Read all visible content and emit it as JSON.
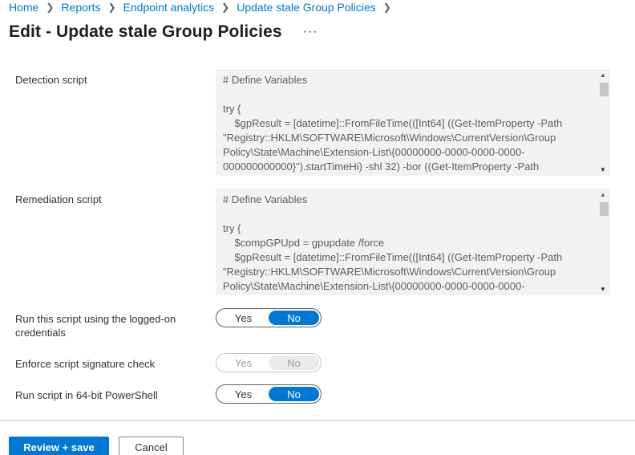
{
  "breadcrumb": [
    "Home",
    "Reports",
    "Endpoint analytics",
    "Update stale Group Policies"
  ],
  "page": {
    "title": "Edit - Update stale Group Policies",
    "more": "···"
  },
  "fields": {
    "detection": {
      "label": "Detection script",
      "content": "# Define Variables\n\ntry {\n    $gpResult = [datetime]::FromFileTime(([Int64] ((Get-ItemProperty -Path \"Registry::HKLM\\SOFTWARE\\Microsoft\\Windows\\CurrentVersion\\Group Policy\\State\\Machine\\Extension-List\\{00000000-0000-0000-0000-000000000000}\").startTimeHi) -shl 32) -bor ((Get-ItemProperty -Path"
    },
    "remediation": {
      "label": "Remediation script",
      "content": "# Define Variables\n\ntry {\n    $compGPUpd = gpupdate /force\n    $gpResult = [datetime]::FromFileTime(([Int64] ((Get-ItemProperty -Path \"Registry::HKLM\\SOFTWARE\\Microsoft\\Windows\\CurrentVersion\\Group Policy\\State\\Machine\\Extension-List\\{00000000-0000-0000-0000-"
    },
    "logged_on": {
      "label": "Run this script using the logged-on credentials",
      "yes": "Yes",
      "no": "No",
      "selected": "No"
    },
    "signature": {
      "label": "Enforce script signature check",
      "yes": "Yes",
      "no": "No",
      "selected": "No",
      "disabled": true
    },
    "powershell64": {
      "label": "Run script in 64-bit PowerShell",
      "yes": "Yes",
      "no": "No",
      "selected": "No"
    }
  },
  "icons": {
    "chevron": "chevron-right-icon",
    "more": "more-icon",
    "scroll_up": "scroll-up-icon",
    "scroll_down": "scroll-down-icon"
  },
  "colors": {
    "accent": "#0078d4",
    "text": "#323130",
    "script_bg": "#f3f2f1"
  },
  "footer": {
    "primary": "Review + save",
    "secondary": "Cancel"
  }
}
